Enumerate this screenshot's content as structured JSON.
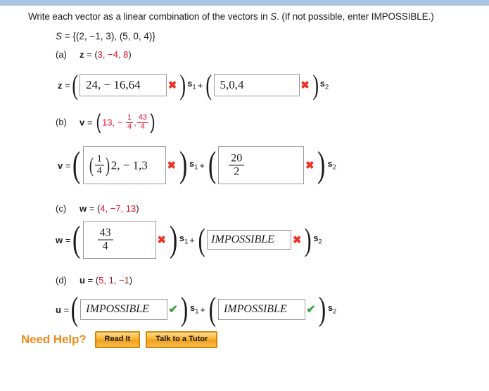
{
  "top_bar_color": "#a8c6df",
  "prompt": {
    "text_before": "Write each vector as a linear combination of the vectors in ",
    "italic_s": "S",
    "text_after": ". (If not possible, enter IMPOSSIBLE.)"
  },
  "set_line": {
    "label": "S",
    "equals": " = {(2, −1, 3), (5, 0, 4)}"
  },
  "parts": [
    {
      "id": "a",
      "label": "(a)",
      "vector_name": "z",
      "vector_eq": " = (",
      "vector_components": "3, −4, 8",
      "vector_close": ")",
      "answer_lead": "z",
      "answer_eq": " = ",
      "box1_value": "24, − 16,64",
      "box1_mark": "x",
      "box1_sub": "s",
      "box1_sub_index": "1",
      "operator": "+",
      "box2_value": "5,0,4",
      "box2_mark": "x",
      "box2_sub": "s",
      "box2_sub_index": "2"
    },
    {
      "id": "b",
      "label": "(b)",
      "vector_name": "v",
      "vector_first": "13,",
      "vector_minus": "−",
      "vector_frac1_num": "1",
      "vector_frac1_den": "4",
      "vector_comma": ",",
      "vector_frac2_num": "43",
      "vector_frac2_den": "4",
      "answer_lead": "v",
      "box1_frac_num": "1",
      "box1_frac_den": "4",
      "box1_rest": "2, − 1,3",
      "box1_mark": "x",
      "box1_sub": "s",
      "box1_sub_index": "1",
      "operator": "+",
      "box2_frac_num": "20",
      "box2_frac_den": "2",
      "box2_mark": "x",
      "box2_sub": "s",
      "box2_sub_index": "2"
    },
    {
      "id": "c",
      "label": "(c)",
      "vector_name": "w",
      "vector_eq": " = (",
      "vector_components": "4, −7, 13",
      "vector_close": ")",
      "answer_lead": "w",
      "box1_frac_num": "43",
      "box1_frac_den": "4",
      "box1_mark": "x",
      "box1_sub": "s",
      "box1_sub_index": "1",
      "operator": "+",
      "box2_value": "IMPOSSIBLE",
      "box2_mark": "x",
      "box2_sub": "s",
      "box2_sub_index": "2"
    },
    {
      "id": "d",
      "label": "(d)",
      "vector_name": "u",
      "vector_eq": " = (",
      "vector_comp_red": "5",
      "vector_comp_rest": ", 1, −1",
      "vector_close": ")",
      "answer_lead": "u",
      "box1_value": "IMPOSSIBLE",
      "box1_mark": "check",
      "box1_sub": "s",
      "box1_sub_index": "1",
      "operator": "+",
      "box2_value": "IMPOSSIBLE",
      "box2_mark": "check",
      "box2_sub": "s",
      "box2_sub_index": "2"
    }
  ],
  "need_help": {
    "label": "Need Help?",
    "read_it": "Read It",
    "talk_to_tutor": "Talk to a Tutor"
  },
  "colors": {
    "red": "#e8112d",
    "dark_red": "#8c1a1a",
    "x_mark": "#ee3124",
    "check_mark": "#3aa33a",
    "orange": "#f08a1e"
  },
  "symbols": {
    "x_mark": "✘",
    "check_mark": "✔",
    "equals": "=",
    "plus": "+",
    "paren_open": "(",
    "paren_close": ")"
  }
}
